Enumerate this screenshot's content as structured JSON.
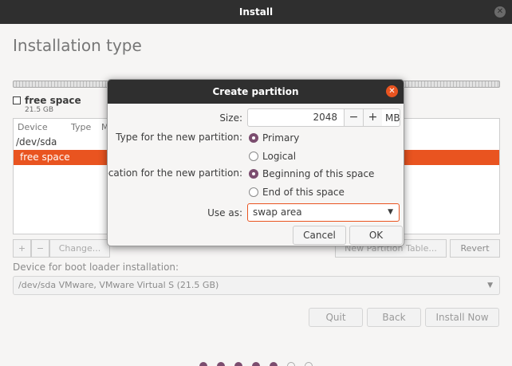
{
  "window": {
    "title": "Install",
    "close_icon": "close-icon"
  },
  "page": {
    "title": "Installation type"
  },
  "partition_legend": {
    "name": "free space",
    "size": "21.5 GB"
  },
  "table": {
    "columns": [
      "Device",
      "Type",
      "M"
    ],
    "rows": [
      {
        "label": "/dev/sda",
        "selected": false
      },
      {
        "label": "free space",
        "selected": true
      }
    ]
  },
  "toolbar": {
    "add_label": "+",
    "remove_label": "−",
    "change_label": "Change...",
    "new_table_label": "New Partition Table...",
    "revert_label": "Revert"
  },
  "bootloader": {
    "label": "Device for boot loader installation:",
    "value": "/dev/sda VMware, VMware Virtual S (21.5 GB)"
  },
  "nav": {
    "quit": "Quit",
    "back": "Back",
    "install_now": "Install Now"
  },
  "progress": {
    "filled": 5,
    "total": 7
  },
  "dialog": {
    "title": "Create partition",
    "size_label": "Size:",
    "size_value": "2048",
    "size_unit": "MB",
    "minus": "−",
    "plus": "+",
    "type_label": "Type for the new partition:",
    "type_options": [
      {
        "label": "Primary",
        "checked": true
      },
      {
        "label": "Logical",
        "checked": false
      }
    ],
    "location_label": "Location for the new partition:",
    "location_options": [
      {
        "label": "Beginning of this space",
        "checked": true
      },
      {
        "label": "End of this space",
        "checked": false
      }
    ],
    "use_as_label": "Use as:",
    "use_as_value": "swap area",
    "cancel": "Cancel",
    "ok": "OK"
  },
  "colors": {
    "accent": "#e95420",
    "radio": "#7b4d6f",
    "titlebar": "#2f2f2f"
  }
}
